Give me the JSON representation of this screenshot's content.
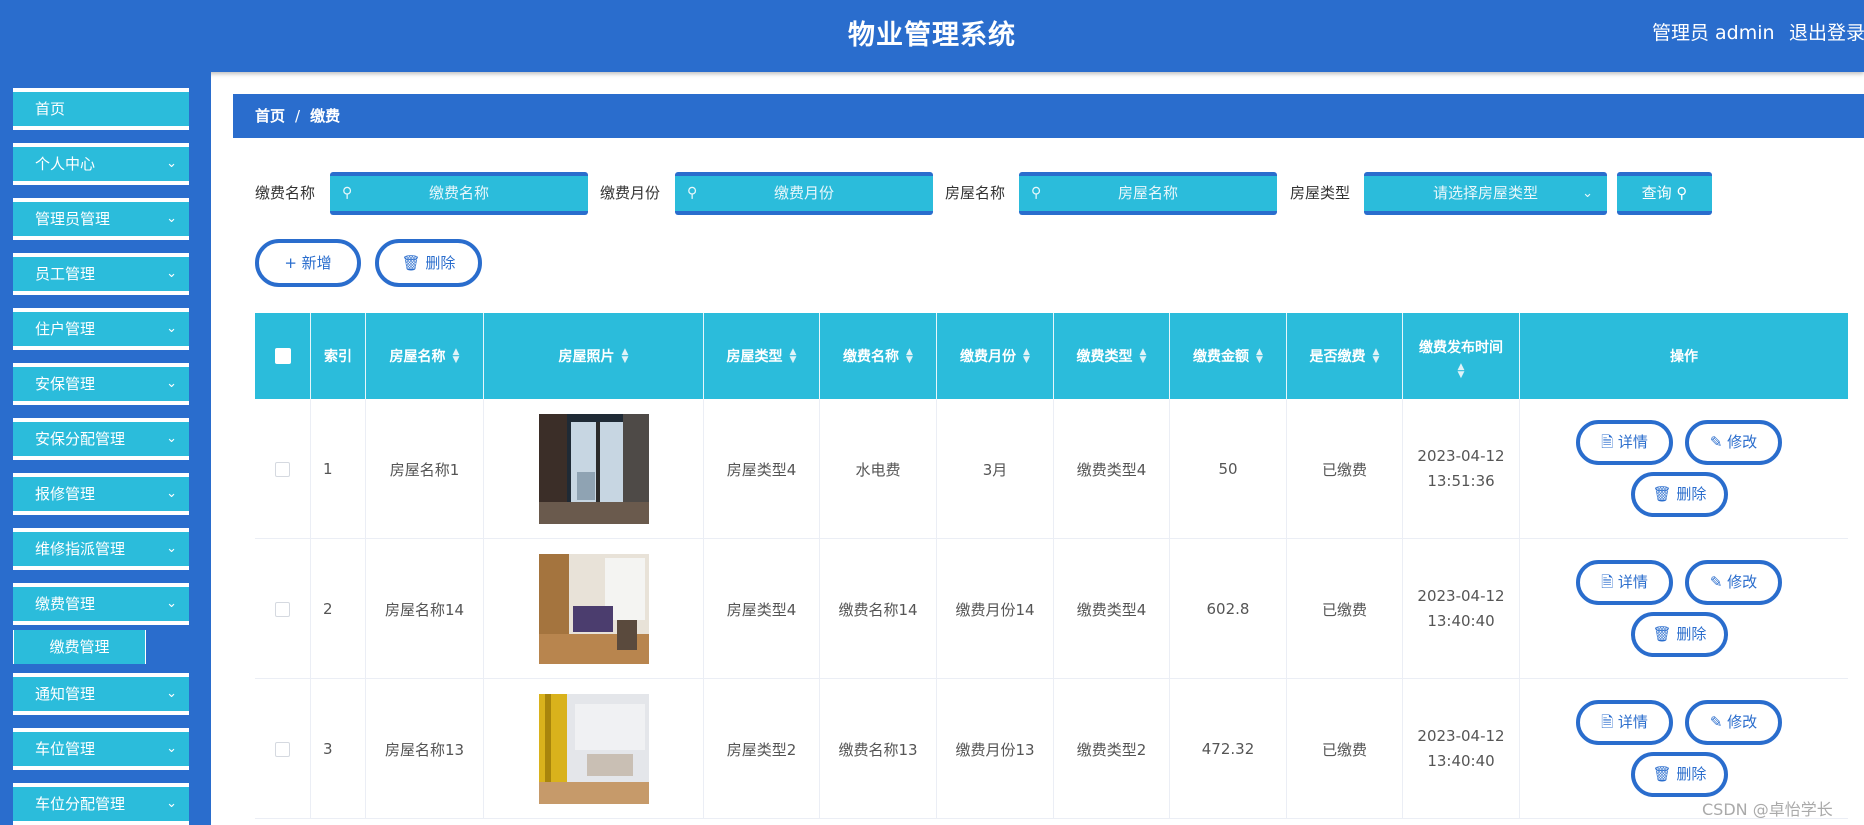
{
  "header": {
    "title": "物业管理系统",
    "user": "管理员 admin",
    "logout": "退出登录"
  },
  "sidebar": {
    "items": [
      {
        "label": "首页",
        "has_children": false
      },
      {
        "label": "个人中心",
        "has_children": true
      },
      {
        "label": "管理员管理",
        "has_children": true
      },
      {
        "label": "员工管理",
        "has_children": true
      },
      {
        "label": "住户管理",
        "has_children": true
      },
      {
        "label": "安保管理",
        "has_children": true
      },
      {
        "label": "安保分配管理",
        "has_children": true
      },
      {
        "label": "报修管理",
        "has_children": true
      },
      {
        "label": "维修指派管理",
        "has_children": true
      },
      {
        "label": "缴费管理",
        "has_children": true,
        "expanded": true
      },
      {
        "label": "通知管理",
        "has_children": true
      },
      {
        "label": "车位管理",
        "has_children": true
      },
      {
        "label": "车位分配管理",
        "has_children": true
      }
    ],
    "active_sub": "缴费管理"
  },
  "breadcrumb": {
    "home": "首页",
    "separator": "/",
    "current": "缴费"
  },
  "search": {
    "fee_name_label": "缴费名称",
    "fee_name_placeholder": "缴费名称",
    "fee_month_label": "缴费月份",
    "fee_month_placeholder": "缴费月份",
    "house_name_label": "房屋名称",
    "house_name_placeholder": "房屋名称",
    "house_type_label": "房屋类型",
    "house_type_placeholder": "请选择房屋类型",
    "query_label": "查询"
  },
  "actions": {
    "add_label": "新增",
    "delete_label": "删除"
  },
  "table": {
    "columns": [
      "索引",
      "房屋名称",
      "房屋照片",
      "房屋类型",
      "缴费名称",
      "缴费月份",
      "缴费类型",
      "缴费金额",
      "是否缴费",
      "缴费发布时间",
      "操作"
    ],
    "rows": [
      {
        "index": "1",
        "house_name": "房屋名称1",
        "house_type": "房屋类型4",
        "fee_name": "水电费",
        "fee_month": "3月",
        "fee_type": "缴费类型4",
        "amount": "50",
        "paid": "已缴费",
        "date": "2023-04-12",
        "time": "13:51:36"
      },
      {
        "index": "2",
        "house_name": "房屋名称14",
        "house_type": "房屋类型4",
        "fee_name": "缴费名称14",
        "fee_month": "缴费月份14",
        "fee_type": "缴费类型4",
        "amount": "602.8",
        "paid": "已缴费",
        "date": "2023-04-12",
        "time": "13:40:40"
      },
      {
        "index": "3",
        "house_name": "房屋名称13",
        "house_type": "房屋类型2",
        "fee_name": "缴费名称13",
        "fee_month": "缴费月份13",
        "fee_type": "缴费类型2",
        "amount": "472.32",
        "paid": "已缴费",
        "date": "2023-04-12",
        "time": "13:40:40"
      }
    ],
    "row_actions": {
      "detail": "详情",
      "edit": "修改",
      "delete": "删除"
    }
  },
  "watermark": "CSDN @卓怡学长",
  "colors": {
    "primary": "#2a6dcd",
    "accent": "#2bbcdb"
  },
  "icons": [
    "search-icon",
    "chevron-down-icon",
    "plus-icon",
    "trash-icon",
    "document-icon",
    "pencil-icon",
    "sort-icon"
  ]
}
